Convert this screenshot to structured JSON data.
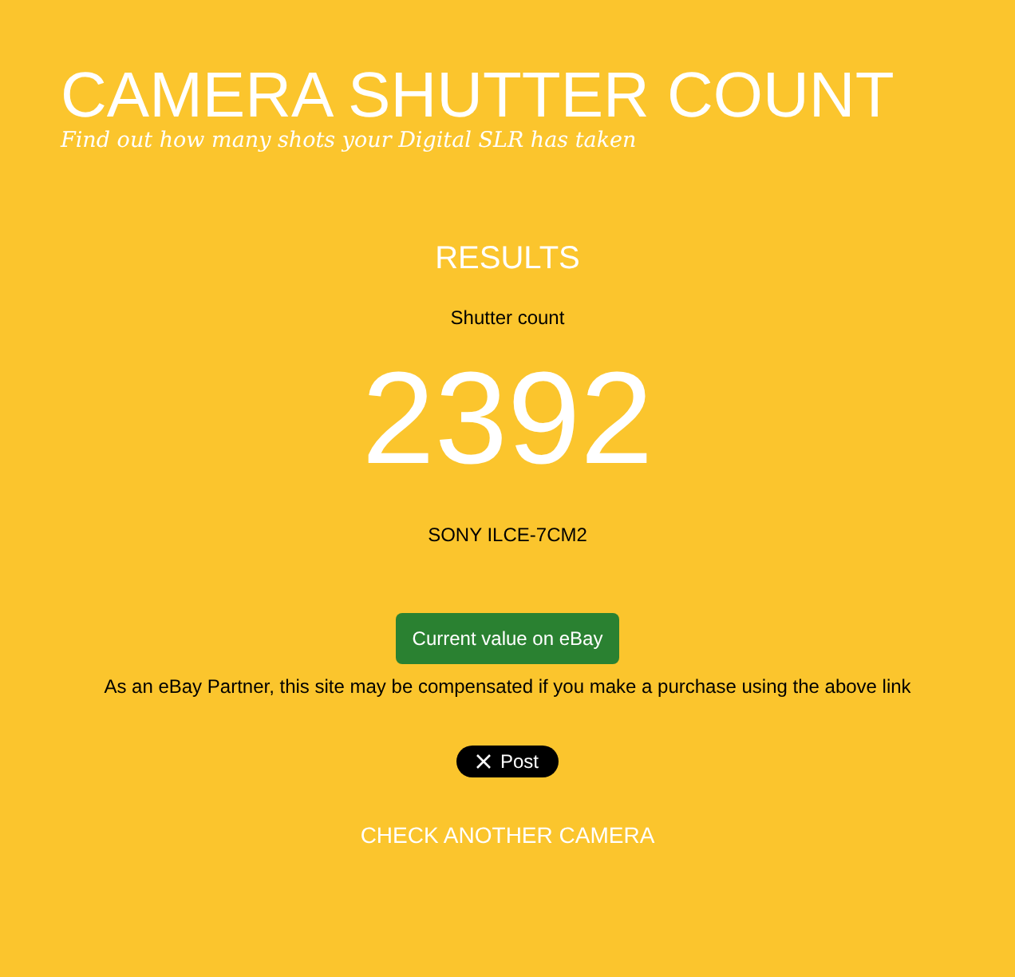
{
  "header": {
    "title": "CAMERA SHUTTER COUNT",
    "tagline": "Find out how many shots your Digital SLR has taken"
  },
  "results": {
    "heading": "RESULTS",
    "label": "Shutter count",
    "count": "2392",
    "camera": "SONY ILCE-7CM2"
  },
  "ebay": {
    "button": "Current value on eBay",
    "disclaimer": "As an eBay Partner, this site may be compensated if you make a purchase using the above link"
  },
  "share": {
    "button": "Post"
  },
  "link": "CHECK ANOTHER CAMERA"
}
